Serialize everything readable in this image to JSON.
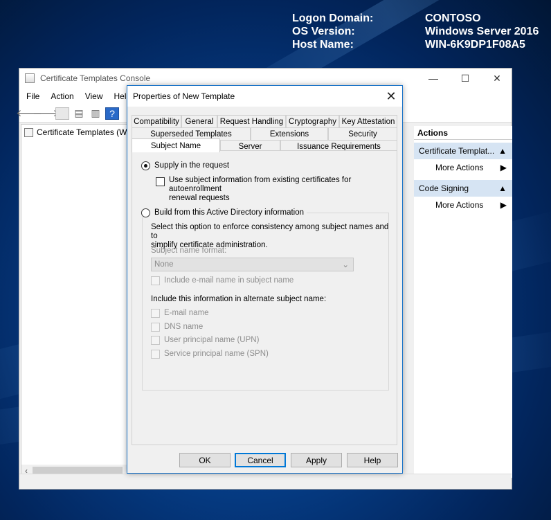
{
  "bginfo": {
    "rows": [
      {
        "label": "Logon Domain:",
        "value": "CONTOSO"
      },
      {
        "label": "OS Version:",
        "value": "Windows Server 2016"
      },
      {
        "label": "Host Name:",
        "value": "WIN-6K9DP1F08A5"
      }
    ]
  },
  "mmc": {
    "title": "Certificate Templates Console",
    "menu": [
      "File",
      "Action",
      "View",
      "Help"
    ],
    "tree_root": "Certificate Templates (W",
    "actions": {
      "header": "Actions",
      "groups": [
        {
          "label": "Certificate Templat...",
          "item": "More Actions"
        },
        {
          "label": "Code Signing",
          "item": "More Actions"
        }
      ]
    },
    "window_controls": {
      "minimize": "—",
      "maximize": "☐",
      "close": "✕"
    }
  },
  "dialog": {
    "title": "Properties of New Template",
    "tabs_row1": [
      "Compatibility",
      "General",
      "Request Handling",
      "Cryptography",
      "Key Attestation"
    ],
    "tabs_row2": [
      "Superseded Templates",
      "Extensions",
      "Security"
    ],
    "tabs_row3": [
      "Subject Name",
      "Server",
      "Issuance Requirements"
    ],
    "selected_tab": "Subject Name",
    "supply_radio": "Supply in the request",
    "use_subject_line1": "Use subject information from existing certificates for autoenrollment",
    "use_subject_line2": "renewal requests",
    "build_radio": "Build from this Active Directory information",
    "build_desc_line1": "Select this option to enforce consistency among subject names and to",
    "build_desc_line2": "simplify certificate administration.",
    "subject_format_label": "Subject name format:",
    "subject_format_value": "None",
    "include_email": "Include e-mail name in subject name",
    "alt_label": "Include this information in alternate subject name:",
    "alt_options": [
      "E-mail name",
      "DNS name",
      "User principal name (UPN)",
      "Service principal name (SPN)"
    ],
    "buttons": {
      "ok": "OK",
      "cancel": "Cancel",
      "apply": "Apply",
      "help": "Help"
    }
  }
}
